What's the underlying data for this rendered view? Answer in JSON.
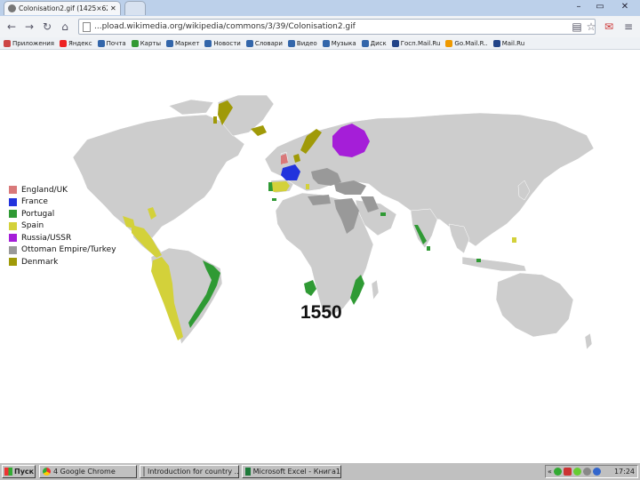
{
  "browser": {
    "tab_title": "Colonisation2.gif (1425×625)",
    "url": "...pload.wikimedia.org/wikipedia/commons/3/39/Colonisation2.gif"
  },
  "bookmarks": [
    {
      "label": "Приложения",
      "color": "#c44"
    },
    {
      "label": "Яндекс",
      "color": "#e22"
    },
    {
      "label": "Почта",
      "color": "#36a"
    },
    {
      "label": "Карты",
      "color": "#393"
    },
    {
      "label": "Маркет",
      "color": "#36a"
    },
    {
      "label": "Новости",
      "color": "#36a"
    },
    {
      "label": "Словари",
      "color": "#36a"
    },
    {
      "label": "Видео",
      "color": "#36a"
    },
    {
      "label": "Музыка",
      "color": "#36a"
    },
    {
      "label": "Диск",
      "color": "#36a"
    },
    {
      "label": "Госп.Mail.Ru",
      "color": "#248"
    },
    {
      "label": "Go.Mail.R..",
      "color": "#e90"
    },
    {
      "label": "Mail.Ru",
      "color": "#248"
    }
  ],
  "legend": [
    {
      "label": "England/UK",
      "color": "#d9797a"
    },
    {
      "label": "France",
      "color": "#2233dd"
    },
    {
      "label": "Portugal",
      "color": "#2f9a34"
    },
    {
      "label": "Spain",
      "color": "#d3d13a"
    },
    {
      "label": "Russia/USSR",
      "color": "#a51ed8"
    },
    {
      "label": "Ottoman Empire/Turkey",
      "color": "#999999"
    },
    {
      "label": "Denmark",
      "color": "#a09a08"
    }
  ],
  "year": "1550",
  "colors": {
    "land": "#cdcdcd",
    "ocean": "#ffffff"
  },
  "taskbar": {
    "start_label": "Пуск",
    "tasks": [
      "4 Google Chrome",
      "Introduction for country ...",
      "Microsoft Excel - Книга1"
    ],
    "clock": "17:24"
  }
}
